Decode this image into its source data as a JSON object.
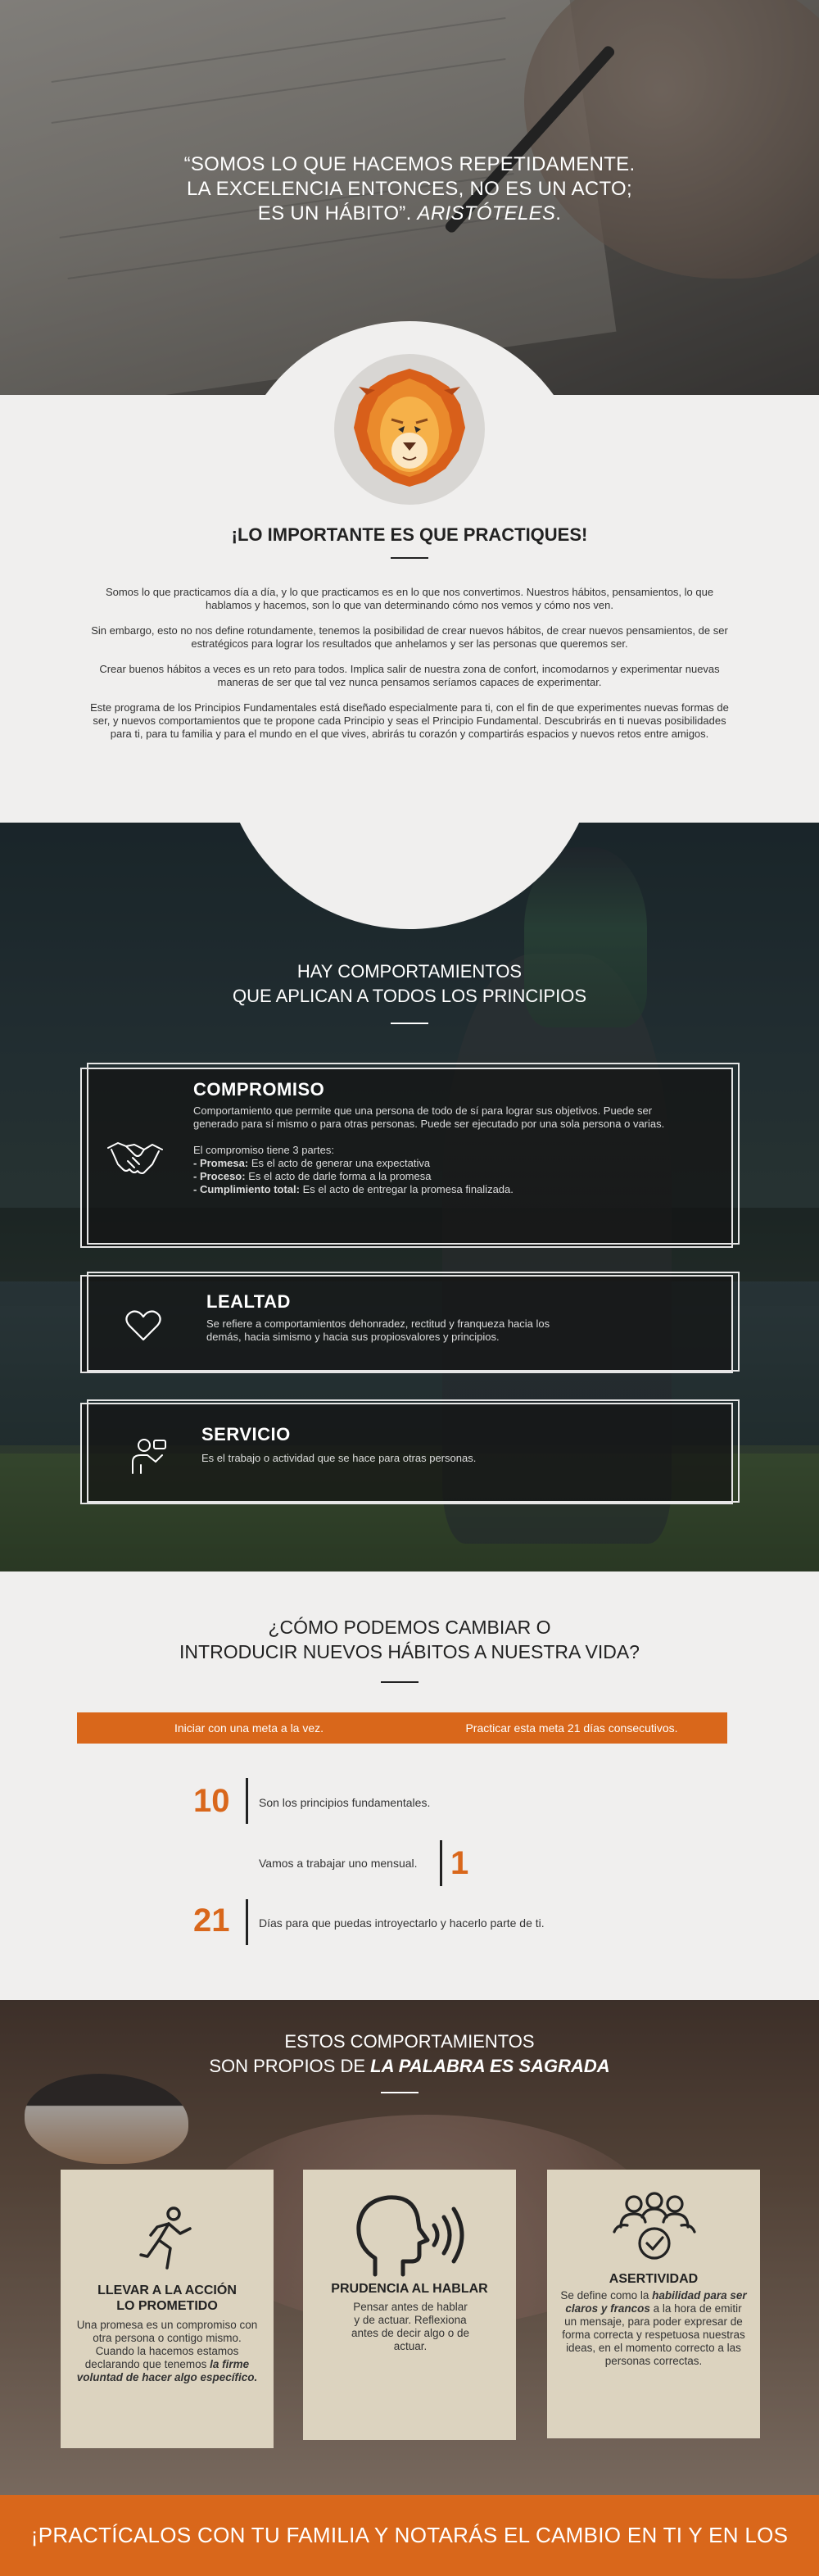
{
  "hero": {
    "quote_line1": "“SOMOS LO QUE HACEMOS REPETIDAMENTE.",
    "quote_line2": "LA EXCELENCIA ENTONCES, NO ES UN ACTO;",
    "quote_line3": "ES UN HÁBITO”.",
    "quote_author": "ARISTÓTELES",
    "quote_end": "."
  },
  "intro": {
    "title": "¡LO IMPORTANTE ES QUE PRACTIQUES!",
    "paragraphs": [
      "Somos lo que practicamos día a día, y lo que practicamos es en lo que nos convertimos. Nuestros hábitos, pensamientos, lo que hablamos y hacemos, son lo que van determinando cómo nos vemos y cómo nos ven.",
      "Sin embargo, esto no nos define rotundamente, tenemos la posibilidad de crear nuevos hábitos, de crear nuevos pensamientos, de ser estratégicos para lograr los resultados que anhelamos y ser las personas que queremos ser.",
      "Crear buenos hábitos a veces es un reto para todos. Implica salir de nuestra zona de confort, incomodarnos y experimentar nuevas maneras de ser que tal vez nunca pensamos seríamos capaces de experimentar.",
      "Este programa de los Principios Fundamentales está diseñado especialmente para ti, con el fin de que experimentes nuevas formas de ser, y nuevos comportamientos que te propone cada Principio y seas el Principio Fundamental. Descubrirás en ti nuevas posibilidades para ti, para tu familia y para el mundo en el que vives, abrirás tu corazón y compartirás espacios y nuevos retos entre amigos."
    ]
  },
  "behaviours": {
    "title_line1": "HAY COMPORTAMIENTOS",
    "title_line2": "QUE APLICAN A TODOS LOS PRINCIPIOS",
    "compromiso": {
      "title": "COMPROMISO",
      "desc": "Comportamiento que permite que una persona de todo de sí para lograr sus objetivos. Puede ser generado para sí mismo o para otras personas. Puede ser ejecutado por una sola persona o varias.",
      "parts_intro": "El compromiso tiene 3 partes:",
      "p1_label": "- Promesa:",
      "p1_text": " Es el acto de generar una expectativa",
      "p2_label": "- Proceso:",
      "p2_text": " Es el acto de darle forma a la promesa",
      "p3_label": "- Cumplimiento total:",
      "p3_text": " Es el acto de entregar la promesa finalizada."
    },
    "lealtad": {
      "title": "LEALTAD",
      "desc": "Se refiere a comportamientos dehonradez, rectitud y franqueza hacia los demás, hacia simismo y hacia sus propiosvalores y principios."
    },
    "servicio": {
      "title": "SERVICIO",
      "desc": "Es el trabajo o actividad que se hace para otras personas."
    }
  },
  "habits": {
    "title_line1": "¿CÓMO PODEMOS CAMBIAR O",
    "title_line2": "INTRODUCIR NUEVOS HÁBITOS A NUESTRA VIDA?",
    "pill1": "Iniciar con una meta a la vez.",
    "pill2": "Practicar esta meta 21 días consecutivos.",
    "stats": [
      {
        "num": "10",
        "text": "Son los principios fundamentales."
      },
      {
        "num": "1",
        "text": "Vamos a trabajar uno mensual."
      },
      {
        "num": "21",
        "text": "Días para que puedas introyectarlo y hacerlo parte de ti."
      }
    ]
  },
  "word": {
    "title_line1": "ESTOS COMPORTAMIENTOS",
    "title_line2_a": "SON PROPIOS DE ",
    "title_line2_b": "LA PALABRA ES SAGRADA",
    "boxes": [
      {
        "title_l1": "LLEVAR A LA ACCIÓN",
        "title_l2": "LO PROMETIDO",
        "text_a": "Una promesa es un compromiso con otra persona o contigo mismo. Cuando la hacemos estamos declarando que tenemos ",
        "text_em": "la firme voluntad de hacer algo específico.",
        "icon": "running-person-icon"
      },
      {
        "title_l1": "PRUDENCIA AL HABLAR",
        "text_a": "Pensar antes de hablar y de actuar. Reflexiona antes de decir algo o de actuar.",
        "icon": "speaking-head-icon"
      },
      {
        "title_l1": "ASERTIVIDAD",
        "text_a": "Se define como la ",
        "text_em": "habilidad para ser claros y francos",
        "text_b": " a la hora de emitir un mensaje, para poder expresar de forma correcta y respetuosa nuestras ideas, en el momento correcto a las personas correctas.",
        "icon": "group-check-icon"
      }
    ]
  },
  "footer": {
    "text": "¡PRACTÍCALOS CON TU FAMILIA Y NOTARÁS EL CAMBIO EN TI Y EN LOS DEMÁS!"
  },
  "colors": {
    "accent": "#d9671b",
    "box_bg": "#dcd3bf",
    "light_bg": "#f0efee"
  }
}
